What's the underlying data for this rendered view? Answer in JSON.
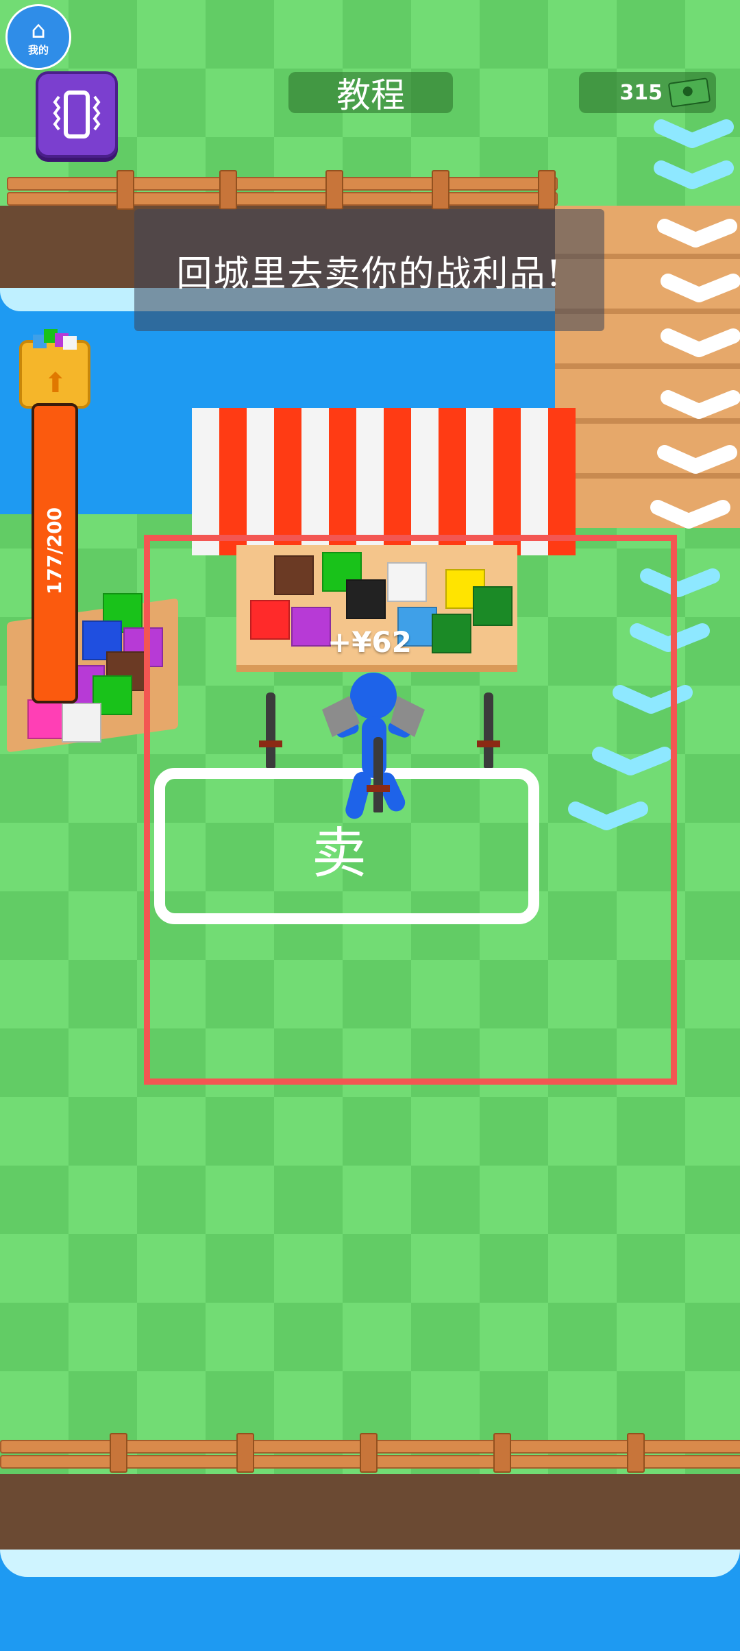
{
  "hud": {
    "home_badge_label": "我的",
    "title": "教程",
    "cash": "315",
    "vibrate_icon": "vibrate-phone-icon",
    "cash_icon": "cash-bill-icon"
  },
  "tutorial": {
    "message": "回城里去卖你的战利品!"
  },
  "capacity": {
    "text": "177/200",
    "fraction": 0.885,
    "icon": "backpack-upgrade-icon"
  },
  "scene": {
    "sell_label": "卖",
    "income_popup": "+¥62"
  },
  "colors": {
    "grass_light": "#72dc74",
    "grass_dark": "#62cc65",
    "water": "#1e9af2",
    "sell_zone_border": "#f35652",
    "capacity_bar": "#fb5a0e",
    "player": "#1e63e9",
    "awning_red": "#ff3b14",
    "button_purple": "#7b3fcf"
  }
}
